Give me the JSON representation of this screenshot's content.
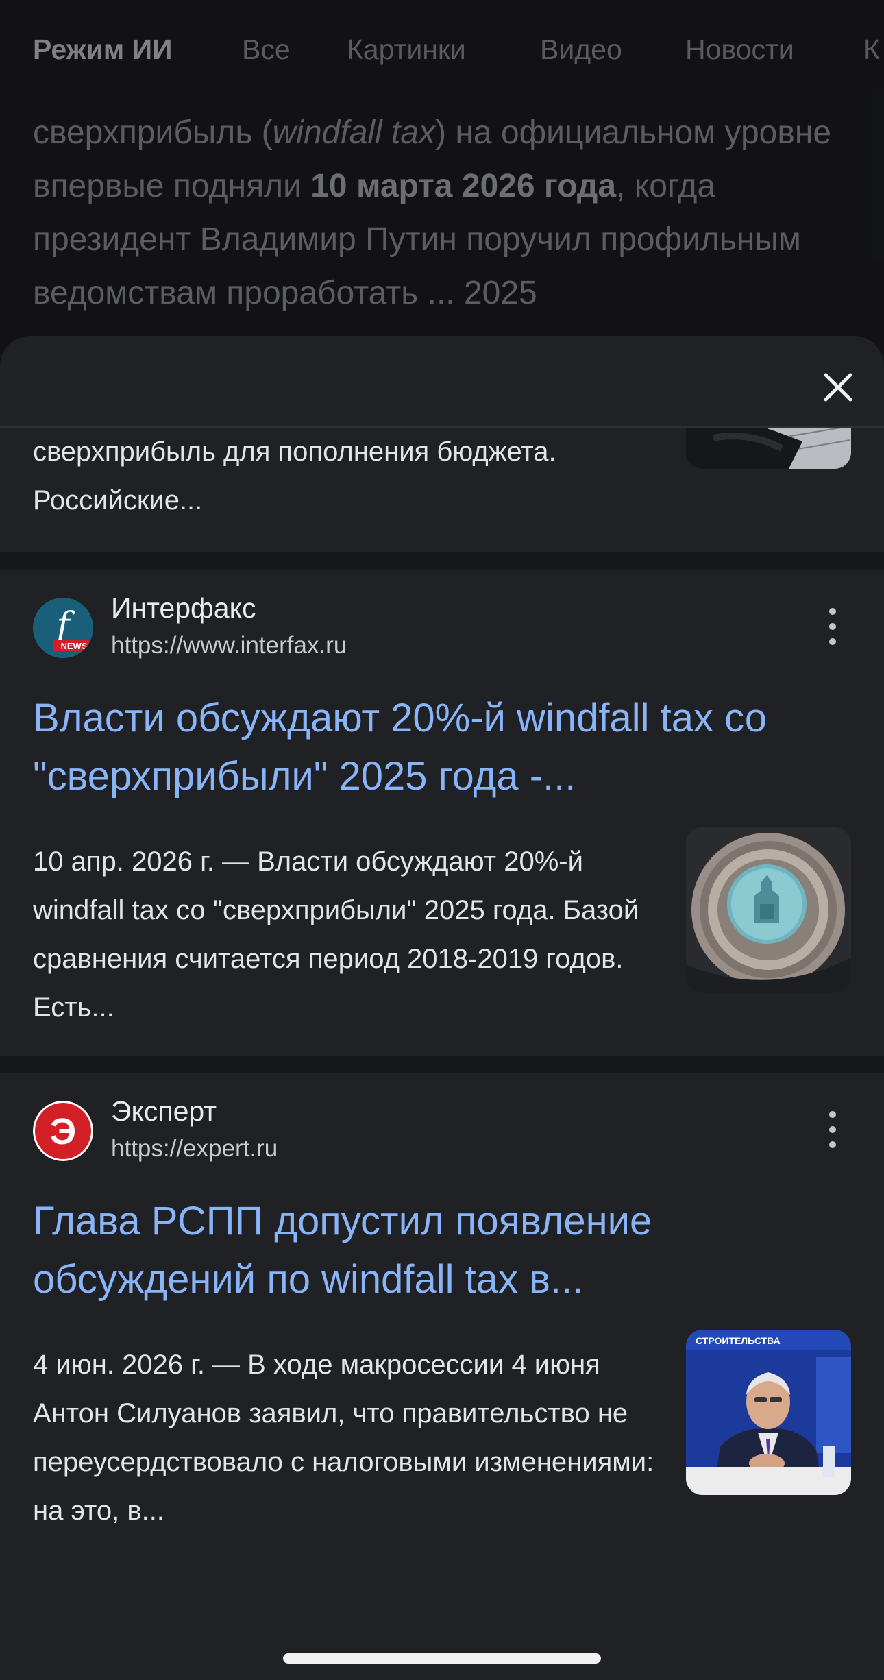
{
  "tabs": [
    "Режим ИИ",
    "Все",
    "Картинки",
    "Видео",
    "Новости",
    "К"
  ],
  "background_text": {
    "part1": "сверхприбыль (",
    "italic": "windfall tax",
    "part2": ") на официальном уровне впервые подняли ",
    "bold": "10 марта 2026 года",
    "part3": ", когда президент Владимир Путин поручил профильным ведомствам проработать ... 2025"
  },
  "previous_card": {
    "snippet": "сверхприбыль для пополнения бюджета. Российские..."
  },
  "results": [
    {
      "source_name": "Интерфакс",
      "url": "https://www.interfax.ru",
      "logo_text": "f",
      "logo_sub": "NEWS",
      "title": "Власти обсуждают 20%-й windfall tax со \"сверхприбыли\" 2025 года -...",
      "snippet": "10 апр. 2026 г. — Власти обсуждают 20%-й windfall tax со \"сверхприбыли\" 2025 года. Базой сравнения считается период 2018-2019 годов. Есть...",
      "thumb_icon": "rolled-banknotes-image"
    },
    {
      "source_name": "Эксперт",
      "url": "https://expert.ru",
      "logo_text": "Э",
      "title": "Глава РСПП допустил появление обсуждений по windfall tax в...",
      "snippet": "4 июн. 2026 г. — В ходе макросессии 4 июня Антон Силуанов заявил, что правительство не переусердствовало с налоговыми изменениями: на это, в...",
      "thumb_text": "СТРОИТЕЛЬСТВА",
      "thumb_icon": "speaker-photo-image"
    }
  ],
  "colors": {
    "link": "#8ab4f8",
    "sheet_bg": "#202125",
    "interfax_logo": "#1a5f7a",
    "expert_logo": "#d32027"
  }
}
